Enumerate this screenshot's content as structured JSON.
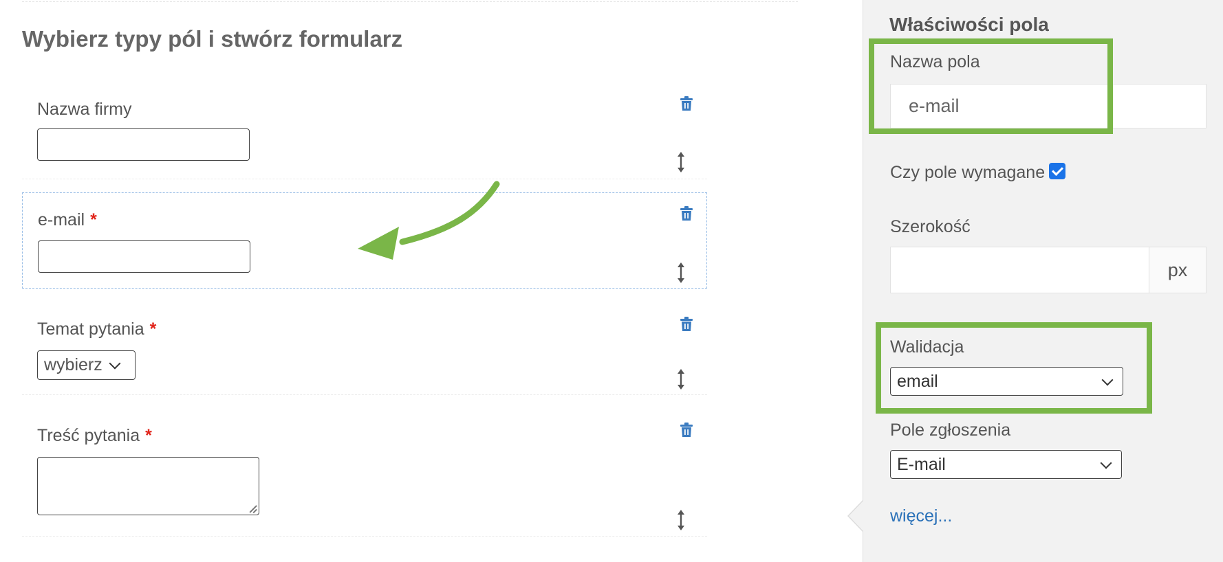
{
  "form_builder": {
    "heading": "Wybierz typy pól i stwórz formularz",
    "fields": [
      {
        "label": "Nazwa firmy",
        "required": "",
        "type": "text"
      },
      {
        "label": "e-mail",
        "required": "*",
        "type": "text",
        "selected": true
      },
      {
        "label": "Temat pytania",
        "required": "*",
        "type": "select",
        "select_value": "wybierz"
      },
      {
        "label": "Treść pytania",
        "required": "*",
        "type": "textarea"
      }
    ],
    "icons": {
      "delete": "trash-icon",
      "reorder": "vertical-resize-arrows-icon"
    }
  },
  "properties_panel": {
    "title": "Właściwości pola",
    "name_label": "Nazwa pola",
    "name_value": "e-mail",
    "required_label": "Czy pole wymagane",
    "required_checked": true,
    "width_label": "Szerokość",
    "width_value": "",
    "width_unit": "px",
    "validation_label": "Walidacja",
    "validation_value": "email",
    "ticket_field_label": "Pole zgłoszenia",
    "ticket_field_value": "E-mail",
    "more_link": "więcej..."
  },
  "colors": {
    "highlight": "#7ab648",
    "required_star": "#e1251b",
    "icon_blue": "#3a7bc0",
    "link": "#2a71b8",
    "checkbox": "#1a73e8"
  }
}
